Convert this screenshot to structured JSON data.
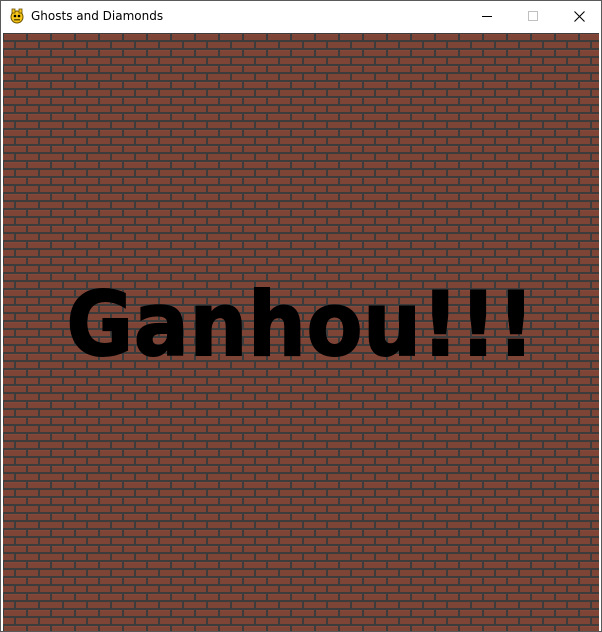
{
  "window": {
    "title": "Ghosts and Diamonds",
    "icon": "pygame-snake-icon",
    "controls": {
      "minimize_icon": "minimize-icon",
      "maximize_icon": "maximize-icon",
      "close_icon": "close-icon"
    }
  },
  "game": {
    "background": "brick-wall",
    "brick_color": "#7e4436",
    "mortar_color": "#3c3c3c",
    "message": "Ganhou!!!"
  }
}
